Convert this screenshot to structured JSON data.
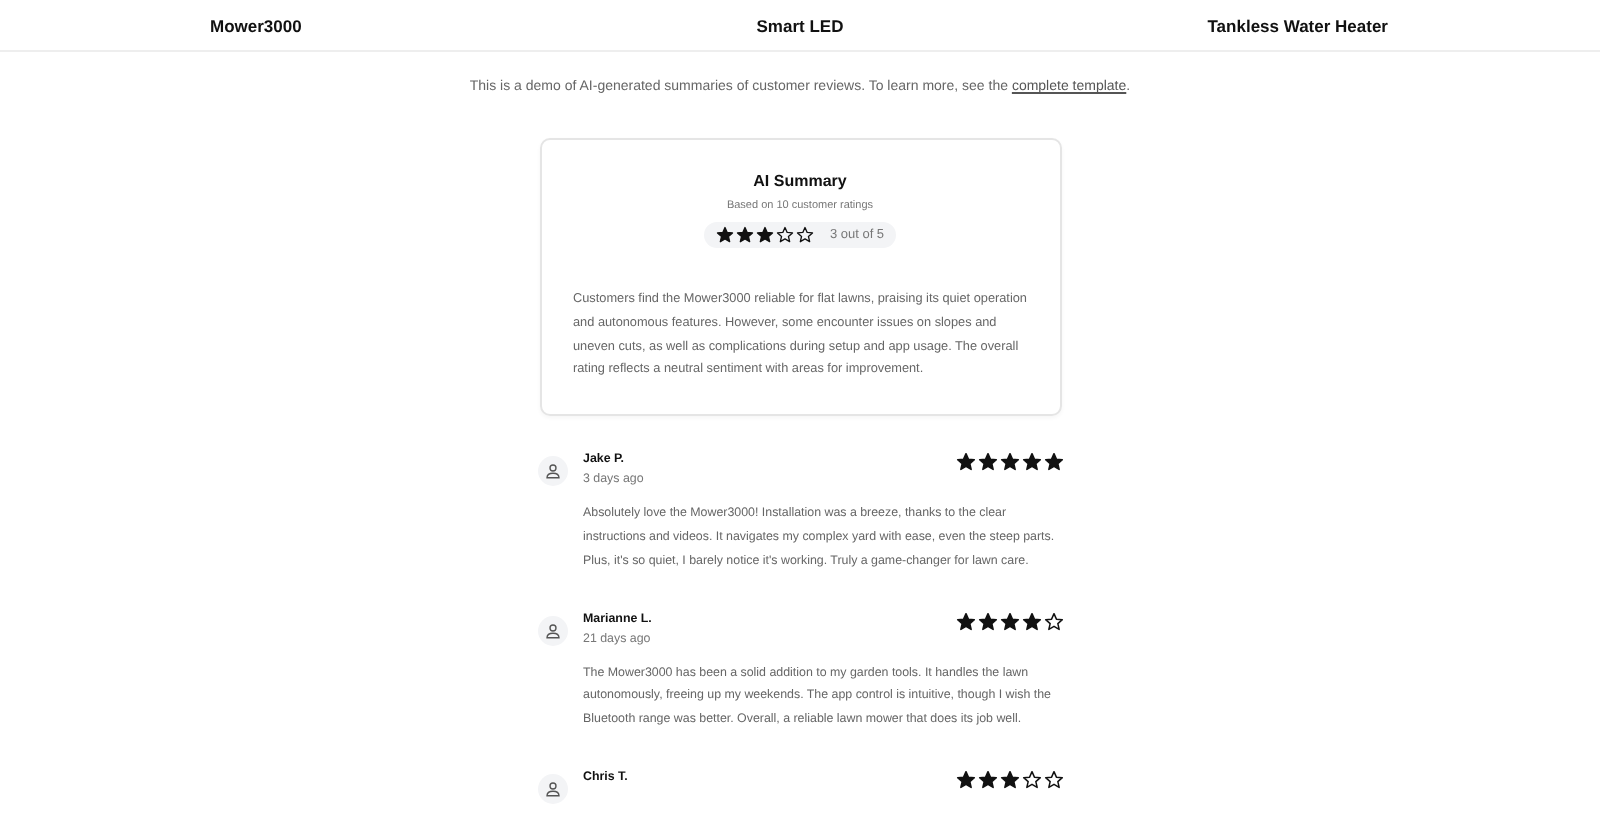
{
  "nav": [
    {
      "label": "Mower3000"
    },
    {
      "label": "Smart LED"
    },
    {
      "label": "Tankless Water Heater"
    }
  ],
  "intro": {
    "text": "This is a demo of AI-generated summaries of customer reviews. To learn more, see the",
    "link": "complete template",
    "end": "."
  },
  "summary": {
    "title": "AI Summary",
    "subtitle": "Based on 10 customer ratings",
    "stars": 3,
    "reading": "3 out of 5",
    "text": "Customers find the Mower3000 reliable for flat lawns, praising its quiet operation and autonomous features. However, some encounter issues on slopes and uneven cuts, as well as complications during setup and app usage. The overall rating reflects a neutral sentiment with areas for improvement."
  },
  "reviews": [
    {
      "name": "Jake P.",
      "date": "3 days ago",
      "stars": 5,
      "text": "Absolutely love the Mower3000! Installation was a breeze, thanks to the clear instructions and videos. It navigates my complex yard with ease, even the steep parts. Plus, it's so quiet, I barely notice it's working. Truly a game-changer for lawn care."
    },
    {
      "name": "Marianne L.",
      "date": "21 days ago",
      "stars": 4,
      "text": "The Mower3000 has been a solid addition to my garden tools. It handles the lawn autonomously, freeing up my weekends. The app control is intuitive, though I wish the Bluetooth range was better. Overall, a reliable lawn mower that does its job well."
    },
    {
      "name": "Chris T.",
      "stars": 3
    }
  ]
}
